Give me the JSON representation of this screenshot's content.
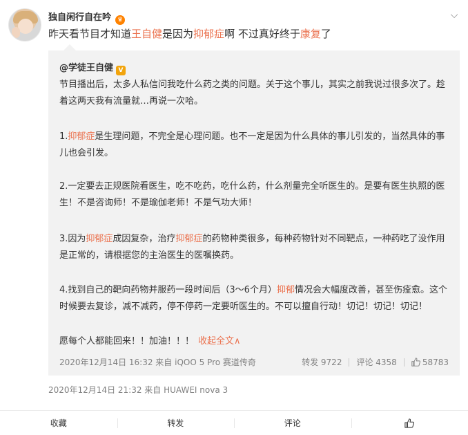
{
  "post": {
    "author": "独自闲行自在吟",
    "text_parts": [
      "昨天看节目才知道",
      "王自健",
      "是因为",
      "抑郁症",
      "啊 不过真好终于",
      "康复",
      "了"
    ],
    "meta": "2020年12月14日 21:32  来自 HUAWEI nova 3"
  },
  "repost": {
    "author": "@学徒王自健",
    "paragraphs": {
      "p0": "节目播出后，太多人私信问我吃什么药之类的问题。关于这个事儿，其实之前我说过很多次了。趁着这两天我有流量就…再说一次哈。",
      "p1_parts": [
        "1.",
        "抑郁症",
        "是生理问题，不完全是心理问题。也不一定是因为什么具体的事儿引发的，当然具体的事儿也会引发。"
      ],
      "p2": "2.一定要去正规医院看医生，吃不吃药，吃什么药，什么剂量完全听医生的。是要有医生执照的医生！不是咨询师！不是瑜伽老师！不是气功大师！",
      "p3_parts": [
        "3.因为",
        "抑郁症",
        "成因复杂，治疗",
        "抑郁症",
        "的药物种类很多，每种药物针对不同靶点，一种药吃了没作用是正常的，请根据您的主治医生的医嘱换药。"
      ],
      "p4_parts": [
        "4.找到自己的靶向药物并服药一段时间后（3～6个月）",
        "抑郁",
        "情况会大幅度改善，甚至伤痊愈。这个时候要去复诊，减不减药，停不停药一定要听医生的。不可以擅自行动！切记！切记！切记！"
      ],
      "p5": "愿每个人都能回来！！加油！！！",
      "collapse": "收起全文∧"
    },
    "meta": "2020年12月14日 16:32 来自 iQOO 5 Pro 赛道传奇",
    "reposts": "转发 9722",
    "comments": "评论 4358",
    "likes": "58783"
  },
  "actions": {
    "favorite": "收藏",
    "repost": "转发",
    "comment": "评论"
  },
  "colors": {
    "highlight": "#eb7350",
    "repost_bg": "#f2f2f2"
  },
  "icons": [
    "avatar",
    "vip-icon",
    "chevron-down-icon",
    "orig-vip-icon",
    "like-icon"
  ]
}
